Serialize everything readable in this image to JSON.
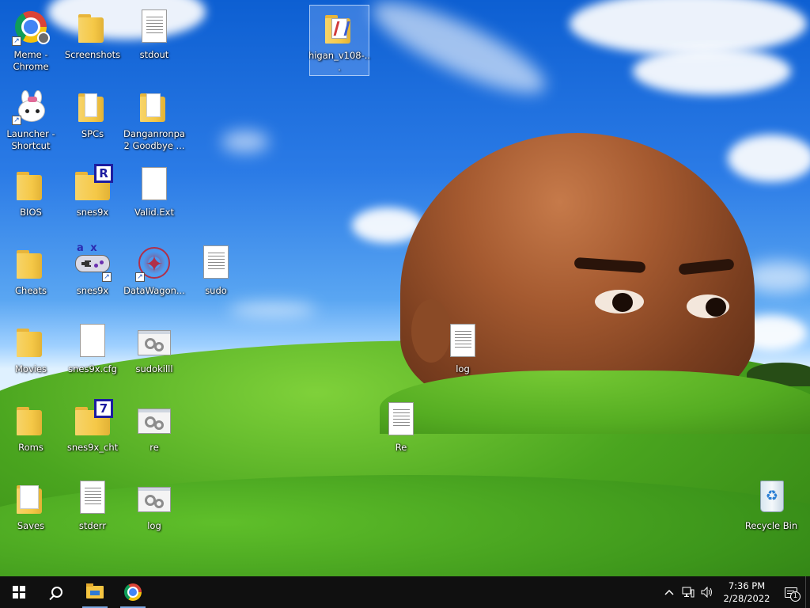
{
  "desktop": {
    "icons": [
      {
        "id": "meme-chrome",
        "label": "Meme - Chrome",
        "type": "chrome-shortcut"
      },
      {
        "id": "screenshots",
        "label": "Screenshots",
        "type": "folder"
      },
      {
        "id": "stdout",
        "label": "stdout",
        "type": "text-file"
      },
      {
        "id": "higan",
        "label": "higan_v108-...",
        "type": "folder-higan",
        "selected": true
      },
      {
        "id": "launcher",
        "label": "Launcher - Shortcut",
        "type": "bunny-shortcut"
      },
      {
        "id": "spcs",
        "label": "SPCs",
        "type": "folder"
      },
      {
        "id": "danganronpa",
        "label": "Danganronpa 2 Goodbye ...",
        "type": "folder"
      },
      {
        "id": "bios",
        "label": "BIOS",
        "type": "folder"
      },
      {
        "id": "snes9x-folder",
        "label": "snes9x",
        "type": "folder-r"
      },
      {
        "id": "valid-ext",
        "label": "Valid.Ext",
        "type": "blank-file"
      },
      {
        "id": "cheats",
        "label": "Cheats",
        "type": "folder"
      },
      {
        "id": "snes9x-app",
        "label": "snes9x",
        "type": "gamepad-shortcut"
      },
      {
        "id": "datawagon",
        "label": "DataWagon...",
        "type": "mandala-shortcut"
      },
      {
        "id": "sudo",
        "label": "sudo",
        "type": "text-file"
      },
      {
        "id": "movies",
        "label": "Movies",
        "type": "folder"
      },
      {
        "id": "snes9x-cfg",
        "label": "snes9x.cfg",
        "type": "blank-file"
      },
      {
        "id": "sudokilll",
        "label": "sudokilll",
        "type": "gear-file"
      },
      {
        "id": "log-mid",
        "label": "log",
        "type": "text-file"
      },
      {
        "id": "roms",
        "label": "Roms",
        "type": "folder"
      },
      {
        "id": "snes9x-cht",
        "label": "snes9x_cht",
        "type": "folder-7"
      },
      {
        "id": "re-gear",
        "label": "re",
        "type": "gear-file"
      },
      {
        "id": "re-doc",
        "label": "Re",
        "type": "text-file"
      },
      {
        "id": "saves",
        "label": "Saves",
        "type": "folder"
      },
      {
        "id": "stderr",
        "label": "stderr",
        "type": "text-file"
      },
      {
        "id": "log-gear",
        "label": "log",
        "type": "gear-file"
      },
      {
        "id": "recycle-bin",
        "label": "Recycle Bin",
        "type": "recycle-bin"
      }
    ],
    "badges": {
      "r": "R",
      "seven": "7",
      "gamepad_letters": "a x"
    }
  },
  "taskbar": {
    "pinned": [
      "start",
      "search",
      "file-explorer",
      "chrome"
    ],
    "clock": {
      "time": "7:36 PM",
      "date": "2/28/2022"
    },
    "notification_count": "1",
    "tray_icons": [
      "chevron-up-icon",
      "network-icon",
      "volume-icon"
    ]
  },
  "colors": {
    "taskbar": "#101010",
    "folder": "#f5c847",
    "sky": "#2b7be6",
    "grass": "#4aa51f"
  }
}
